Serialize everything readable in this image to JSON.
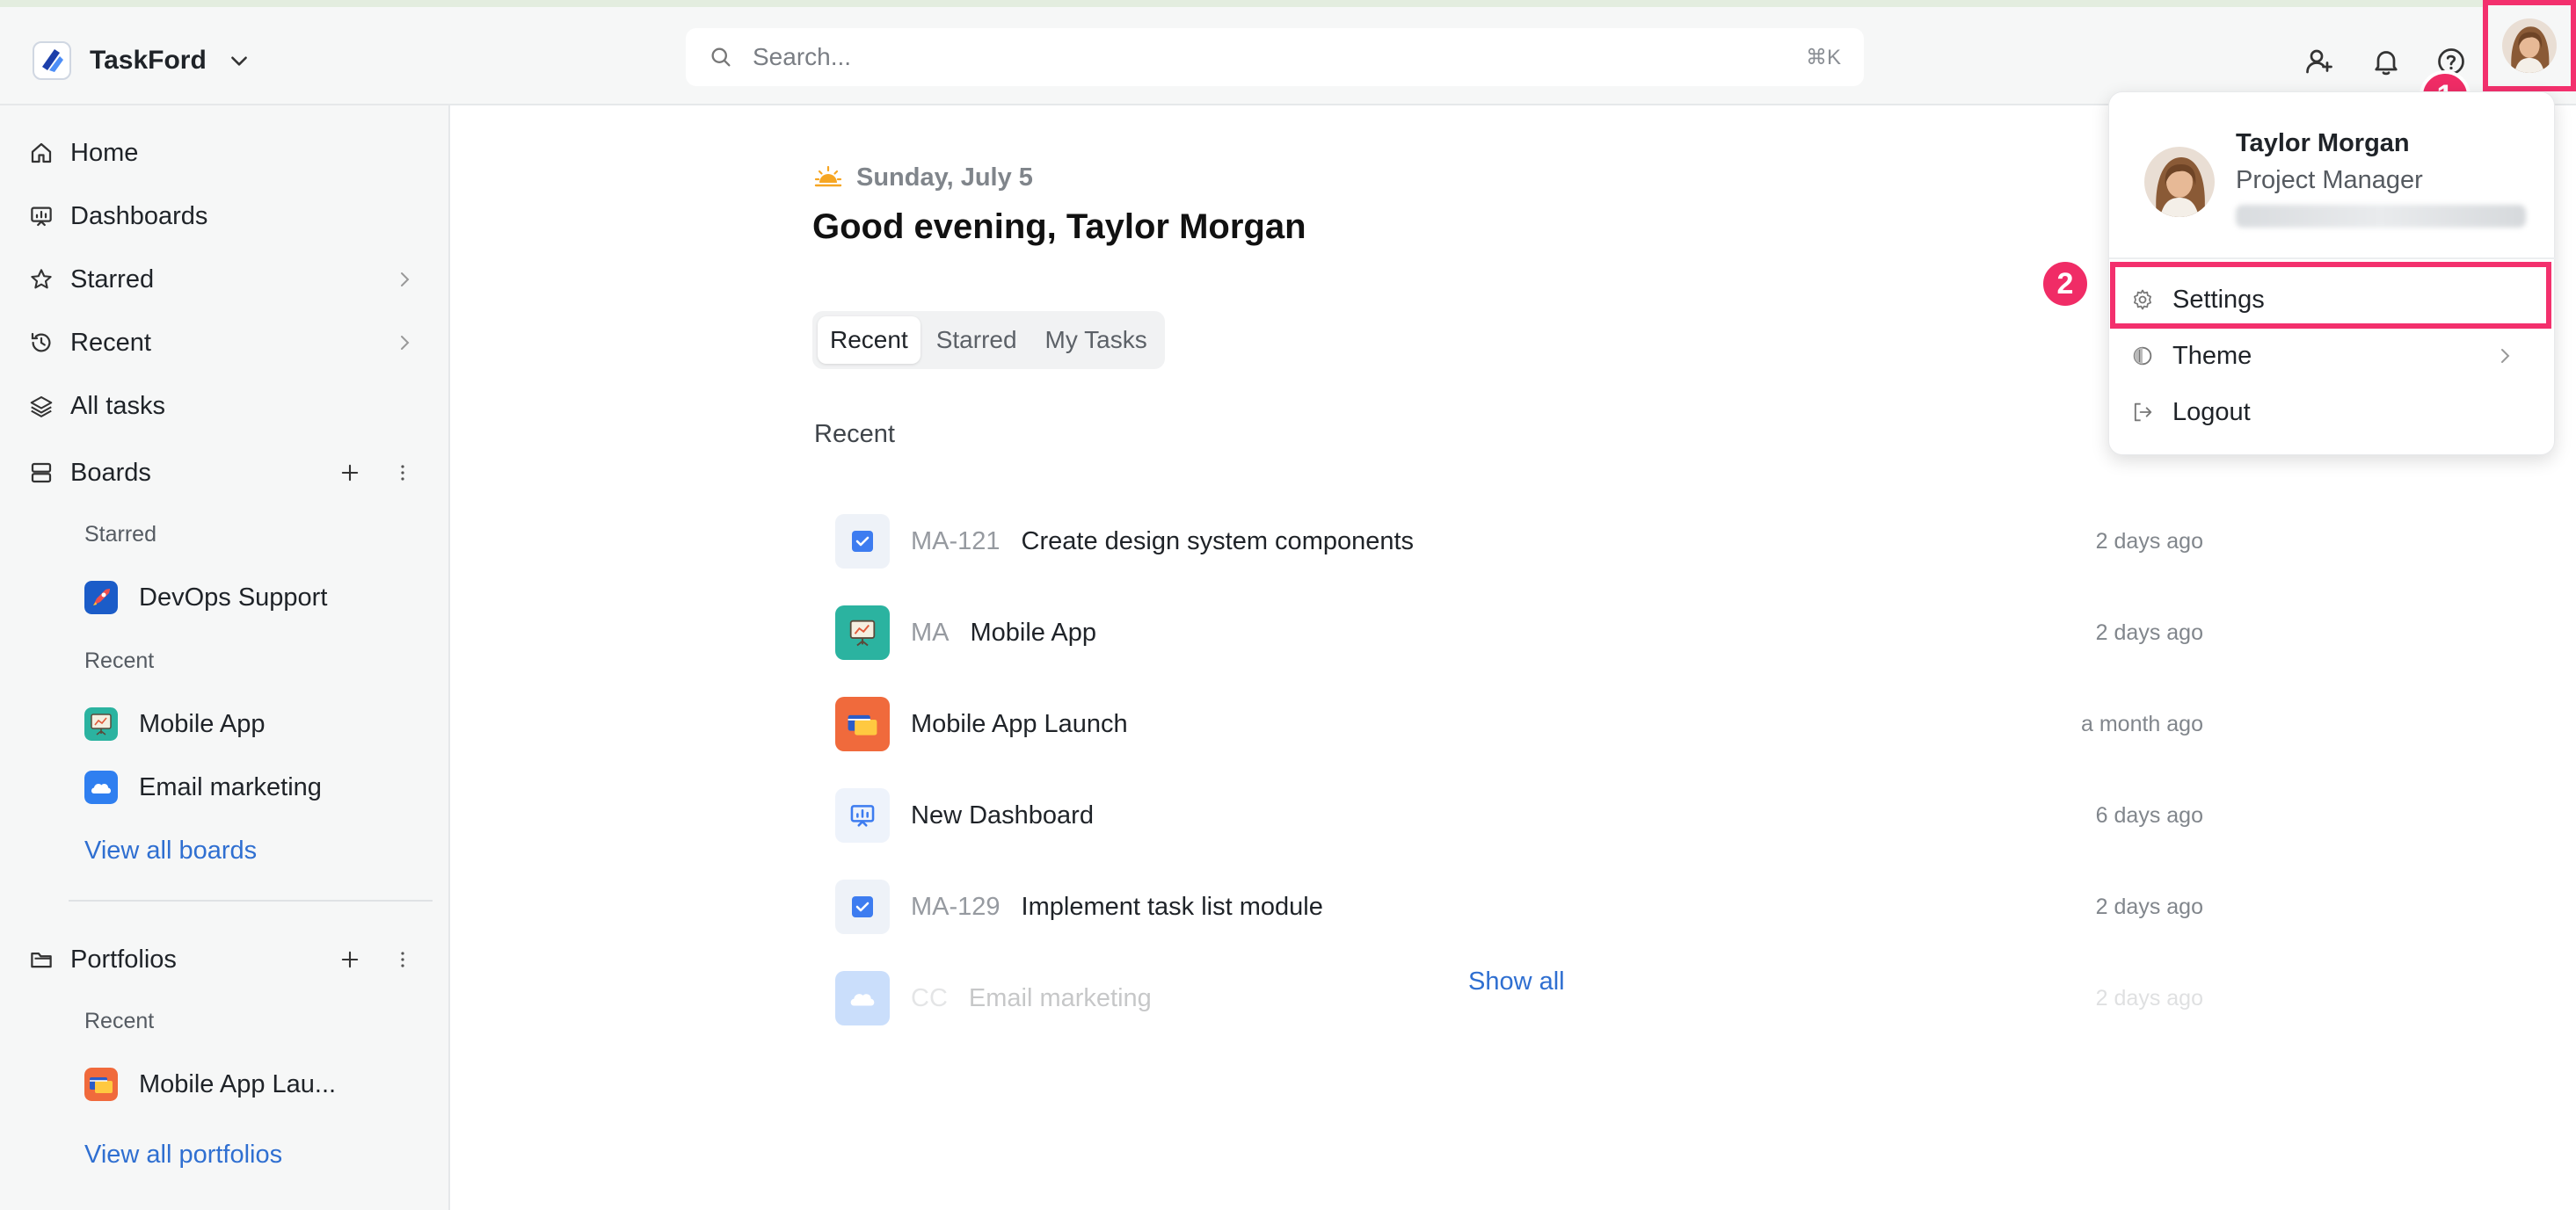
{
  "app": {
    "name": "TaskFord"
  },
  "search": {
    "placeholder": "Search...",
    "shortcut": "⌘K"
  },
  "annotations": {
    "badge1": "1",
    "badge2": "2"
  },
  "sidebar": {
    "nav": [
      {
        "label": "Home",
        "icon": "home-icon"
      },
      {
        "label": "Dashboards",
        "icon": "dashboard-icon"
      },
      {
        "label": "Starred",
        "icon": "star-icon"
      },
      {
        "label": "Recent",
        "icon": "history-icon"
      },
      {
        "label": "All tasks",
        "icon": "layers-icon"
      }
    ],
    "boards": {
      "label": "Boards",
      "starred_label": "Starred",
      "starred": [
        {
          "label": "DevOps Support",
          "icon": "rocket-icon"
        }
      ],
      "recent_label": "Recent",
      "recent": [
        {
          "label": "Mobile App",
          "icon": "presentation-icon"
        },
        {
          "label": "Email marketing",
          "icon": "cloud-icon"
        }
      ],
      "view_all": "View all boards"
    },
    "portfolios": {
      "label": "Portfolios",
      "recent_label": "Recent",
      "recent": [
        {
          "label": "Mobile App Lau...",
          "icon": "cards-icon"
        }
      ],
      "view_all": "View all portfolios"
    }
  },
  "main": {
    "date": "Sunday, July 5",
    "greeting": "Good evening, Taylor Morgan",
    "tabs": [
      "Recent",
      "Starred",
      "My Tasks"
    ],
    "section_title": "Recent",
    "rows": [
      {
        "key": "MA-121",
        "title": "Create design system components",
        "time": "2 days ago",
        "icon": "checkbox-icon"
      },
      {
        "key": "MA",
        "title": "Mobile App",
        "time": "2 days ago",
        "icon": "presentation-icon"
      },
      {
        "key": "",
        "title": "Mobile App Launch",
        "time": "a month ago",
        "icon": "cards-icon"
      },
      {
        "key": "",
        "title": "New Dashboard",
        "time": "6 days ago",
        "icon": "dashboard-icon"
      },
      {
        "key": "MA-129",
        "title": "Implement task list module",
        "time": "2 days ago",
        "icon": "checkbox-icon"
      },
      {
        "key": "CC",
        "title": "Email marketing",
        "time": "2 days ago",
        "icon": "cloud-icon"
      }
    ],
    "show_all": "Show all"
  },
  "user_menu": {
    "name": "Taylor Morgan",
    "role": "Project Manager",
    "items": [
      {
        "label": "Settings",
        "icon": "gear-icon"
      },
      {
        "label": "Theme",
        "icon": "contrast-icon"
      },
      {
        "label": "Logout",
        "icon": "logout-icon"
      }
    ]
  },
  "colors": {
    "accent": "#2f6fd1",
    "highlight": "#f3306d",
    "badge": "#f02c66"
  }
}
